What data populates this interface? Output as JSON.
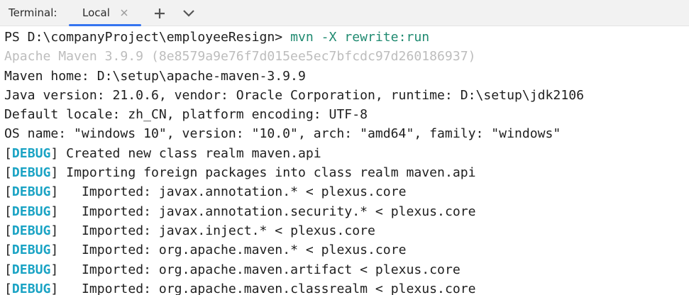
{
  "tabbar": {
    "title": "Terminal:",
    "tabs": [
      {
        "label": "Local"
      }
    ],
    "add_icon": "plus-icon",
    "menu_icon": "chevron-down-icon"
  },
  "colors": {
    "accent": "#3574f0",
    "command": "#1f8a70",
    "muted": "#bdbdbd",
    "debug_tag": "#1aa3c4"
  },
  "terminal": {
    "prompt": "PS D:\\companyProject\\employeeResign> ",
    "command": "mvn -X rewrite:run",
    "lines": [
      "Apache Maven 3.9.9 (8e8579a9e76f7d015ee5ec7bfcdc97d260186937)",
      "Maven home: D:\\setup\\apache-maven-3.9.9",
      "Java version: 21.0.6, vendor: Oracle Corporation, runtime: D:\\setup\\jdk2106",
      "Default locale: zh_CN, platform encoding: UTF-8",
      "OS name: \"windows 10\", version: \"10.0\", arch: \"amd64\", family: \"windows\""
    ],
    "debug_tag": "DEBUG",
    "debug_lines": [
      " Created new class realm maven.api",
      " Importing foreign packages into class realm maven.api",
      "   Imported: javax.annotation.* < plexus.core",
      "   Imported: javax.annotation.security.* < plexus.core",
      "   Imported: javax.inject.* < plexus.core",
      "   Imported: org.apache.maven.* < plexus.core",
      "   Imported: org.apache.maven.artifact < plexus.core",
      "   Imported: org.apache.maven.classrealm < plexus.core"
    ]
  }
}
